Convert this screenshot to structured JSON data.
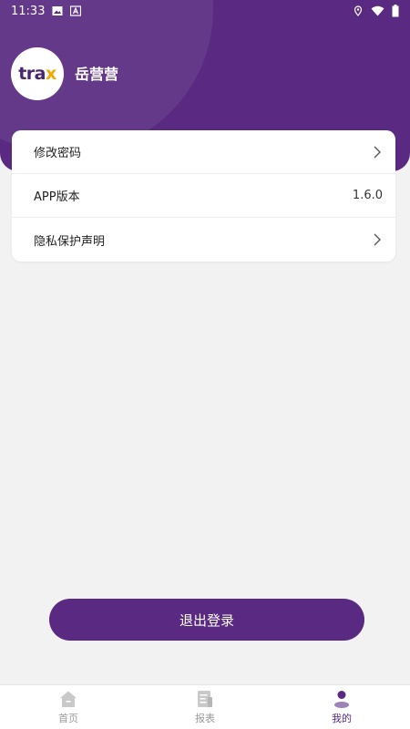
{
  "status_bar": {
    "time": "11:33"
  },
  "profile": {
    "logo_text": "tra",
    "logo_accent": "x",
    "username": "岳营营"
  },
  "settings": {
    "items": [
      {
        "label": "修改密码",
        "value": ""
      },
      {
        "label": "APP版本",
        "value": "1.6.0"
      },
      {
        "label": "隐私保护声明",
        "value": ""
      }
    ]
  },
  "logout": {
    "label": "退出登录"
  },
  "nav": {
    "items": [
      {
        "label": "首页",
        "icon": "home-icon"
      },
      {
        "label": "报表",
        "icon": "report-icon"
      },
      {
        "label": "我的",
        "icon": "profile-icon"
      }
    ],
    "active_index": 2
  },
  "colors": {
    "primary": "#5a2a82",
    "accent": "#f2a900",
    "background": "#f2f2f2"
  }
}
